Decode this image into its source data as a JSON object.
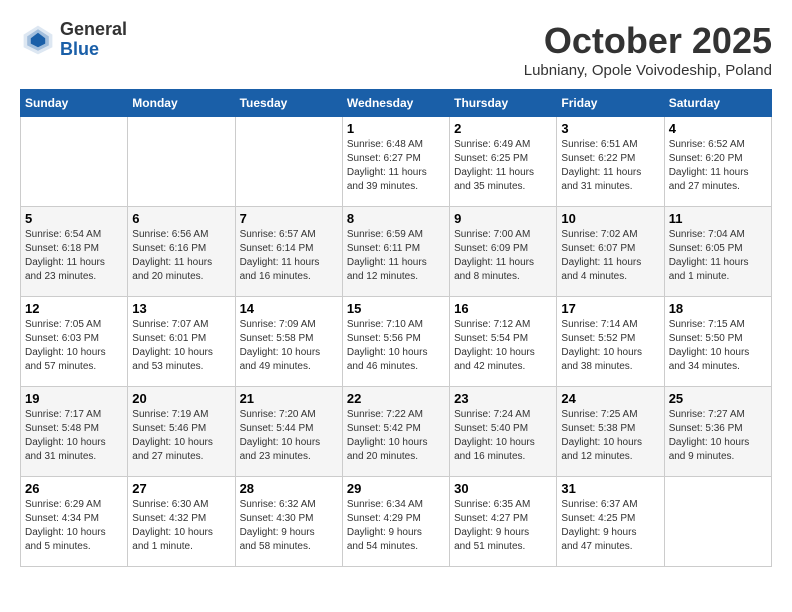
{
  "header": {
    "logo_general": "General",
    "logo_blue": "Blue",
    "month_title": "October 2025",
    "subtitle": "Lubniany, Opole Voivodeship, Poland"
  },
  "days_of_week": [
    "Sunday",
    "Monday",
    "Tuesday",
    "Wednesday",
    "Thursday",
    "Friday",
    "Saturday"
  ],
  "weeks": [
    [
      {
        "day": "",
        "info": ""
      },
      {
        "day": "",
        "info": ""
      },
      {
        "day": "",
        "info": ""
      },
      {
        "day": "1",
        "info": "Sunrise: 6:48 AM\nSunset: 6:27 PM\nDaylight: 11 hours\nand 39 minutes."
      },
      {
        "day": "2",
        "info": "Sunrise: 6:49 AM\nSunset: 6:25 PM\nDaylight: 11 hours\nand 35 minutes."
      },
      {
        "day": "3",
        "info": "Sunrise: 6:51 AM\nSunset: 6:22 PM\nDaylight: 11 hours\nand 31 minutes."
      },
      {
        "day": "4",
        "info": "Sunrise: 6:52 AM\nSunset: 6:20 PM\nDaylight: 11 hours\nand 27 minutes."
      }
    ],
    [
      {
        "day": "5",
        "info": "Sunrise: 6:54 AM\nSunset: 6:18 PM\nDaylight: 11 hours\nand 23 minutes."
      },
      {
        "day": "6",
        "info": "Sunrise: 6:56 AM\nSunset: 6:16 PM\nDaylight: 11 hours\nand 20 minutes."
      },
      {
        "day": "7",
        "info": "Sunrise: 6:57 AM\nSunset: 6:14 PM\nDaylight: 11 hours\nand 16 minutes."
      },
      {
        "day": "8",
        "info": "Sunrise: 6:59 AM\nSunset: 6:11 PM\nDaylight: 11 hours\nand 12 minutes."
      },
      {
        "day": "9",
        "info": "Sunrise: 7:00 AM\nSunset: 6:09 PM\nDaylight: 11 hours\nand 8 minutes."
      },
      {
        "day": "10",
        "info": "Sunrise: 7:02 AM\nSunset: 6:07 PM\nDaylight: 11 hours\nand 4 minutes."
      },
      {
        "day": "11",
        "info": "Sunrise: 7:04 AM\nSunset: 6:05 PM\nDaylight: 11 hours\nand 1 minute."
      }
    ],
    [
      {
        "day": "12",
        "info": "Sunrise: 7:05 AM\nSunset: 6:03 PM\nDaylight: 10 hours\nand 57 minutes."
      },
      {
        "day": "13",
        "info": "Sunrise: 7:07 AM\nSunset: 6:01 PM\nDaylight: 10 hours\nand 53 minutes."
      },
      {
        "day": "14",
        "info": "Sunrise: 7:09 AM\nSunset: 5:58 PM\nDaylight: 10 hours\nand 49 minutes."
      },
      {
        "day": "15",
        "info": "Sunrise: 7:10 AM\nSunset: 5:56 PM\nDaylight: 10 hours\nand 46 minutes."
      },
      {
        "day": "16",
        "info": "Sunrise: 7:12 AM\nSunset: 5:54 PM\nDaylight: 10 hours\nand 42 minutes."
      },
      {
        "day": "17",
        "info": "Sunrise: 7:14 AM\nSunset: 5:52 PM\nDaylight: 10 hours\nand 38 minutes."
      },
      {
        "day": "18",
        "info": "Sunrise: 7:15 AM\nSunset: 5:50 PM\nDaylight: 10 hours\nand 34 minutes."
      }
    ],
    [
      {
        "day": "19",
        "info": "Sunrise: 7:17 AM\nSunset: 5:48 PM\nDaylight: 10 hours\nand 31 minutes."
      },
      {
        "day": "20",
        "info": "Sunrise: 7:19 AM\nSunset: 5:46 PM\nDaylight: 10 hours\nand 27 minutes."
      },
      {
        "day": "21",
        "info": "Sunrise: 7:20 AM\nSunset: 5:44 PM\nDaylight: 10 hours\nand 23 minutes."
      },
      {
        "day": "22",
        "info": "Sunrise: 7:22 AM\nSunset: 5:42 PM\nDaylight: 10 hours\nand 20 minutes."
      },
      {
        "day": "23",
        "info": "Sunrise: 7:24 AM\nSunset: 5:40 PM\nDaylight: 10 hours\nand 16 minutes."
      },
      {
        "day": "24",
        "info": "Sunrise: 7:25 AM\nSunset: 5:38 PM\nDaylight: 10 hours\nand 12 minutes."
      },
      {
        "day": "25",
        "info": "Sunrise: 7:27 AM\nSunset: 5:36 PM\nDaylight: 10 hours\nand 9 minutes."
      }
    ],
    [
      {
        "day": "26",
        "info": "Sunrise: 6:29 AM\nSunset: 4:34 PM\nDaylight: 10 hours\nand 5 minutes."
      },
      {
        "day": "27",
        "info": "Sunrise: 6:30 AM\nSunset: 4:32 PM\nDaylight: 10 hours\nand 1 minute."
      },
      {
        "day": "28",
        "info": "Sunrise: 6:32 AM\nSunset: 4:30 PM\nDaylight: 9 hours\nand 58 minutes."
      },
      {
        "day": "29",
        "info": "Sunrise: 6:34 AM\nSunset: 4:29 PM\nDaylight: 9 hours\nand 54 minutes."
      },
      {
        "day": "30",
        "info": "Sunrise: 6:35 AM\nSunset: 4:27 PM\nDaylight: 9 hours\nand 51 minutes."
      },
      {
        "day": "31",
        "info": "Sunrise: 6:37 AM\nSunset: 4:25 PM\nDaylight: 9 hours\nand 47 minutes."
      },
      {
        "day": "",
        "info": ""
      }
    ]
  ]
}
